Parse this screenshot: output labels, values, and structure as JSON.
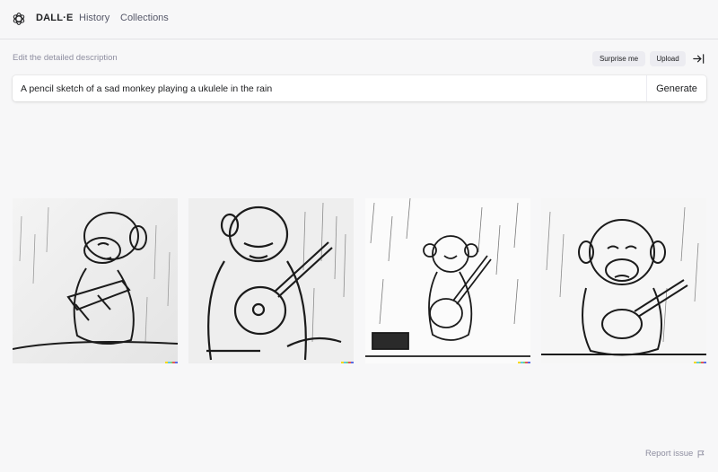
{
  "nav": {
    "logo_icon": "openai-logo-icon",
    "brand": "DALL·E",
    "history": "History",
    "collections": "Collections"
  },
  "editor": {
    "label": "Edit the detailed description",
    "surprise_me": "Surprise me",
    "upload": "Upload",
    "collapse_icon": "collapse-right-icon",
    "prompt_value": "A pencil sketch of a sad monkey playing a ukulele in the rain",
    "generate": "Generate"
  },
  "results": [
    {
      "alt": "pencil sketch monkey 1"
    },
    {
      "alt": "pencil sketch monkey 2"
    },
    {
      "alt": "pencil sketch monkey 3"
    },
    {
      "alt": "pencil sketch monkey 4"
    }
  ],
  "footer": {
    "report_issue": "Report issue",
    "report_icon": "flag-icon"
  },
  "colors": {
    "background": "#f7f7f8",
    "text": "#202123",
    "muted": "#8e8ea0",
    "pill": "#ececf1",
    "signature": [
      "#f5d90a",
      "#5ec9e0",
      "#7fd36b",
      "#e35a5a",
      "#5a6ae3"
    ]
  }
}
